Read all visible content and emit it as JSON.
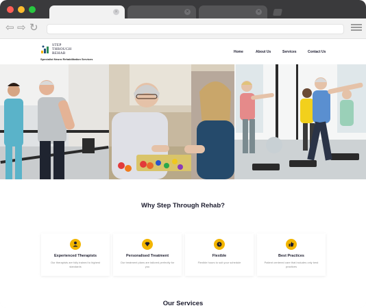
{
  "browser": {
    "tabs": [
      {
        "label": "",
        "close": "×"
      },
      {
        "label": "",
        "close": "×"
      },
      {
        "label": "",
        "close": "×"
      }
    ],
    "nav": {
      "back": "⇦",
      "forward": "⇨",
      "reload": "↻"
    },
    "url": ""
  },
  "site": {
    "logo_line1": "STEP",
    "logo_line2": "THROUGH",
    "logo_line3": "REHAB",
    "tagline": "Specialist Neuro Rehabilitation Services",
    "nav": [
      "Home",
      "About Us",
      "Services",
      "Contact Us"
    ]
  },
  "hero": {
    "panels": [
      "therapist-helping-patient-photo",
      "senior-woman-playing-board-game-photo",
      "seniors-exercise-class-photo"
    ]
  },
  "why": {
    "heading": "Why Step Through Rehab?",
    "cards": [
      {
        "icon": "person-icon",
        "title": "Experienced Therapists",
        "desc": "Our therapists are fully trained to highest standards"
      },
      {
        "icon": "gem-icon",
        "title": "Personalised Treatment",
        "desc": "Our treatment plans are tailored perfectly for you"
      },
      {
        "icon": "clock-icon",
        "title": "Flexible",
        "desc": "Flexible hours to suit your schedule"
      },
      {
        "icon": "thumbs-up-icon",
        "title": "Best Practices",
        "desc": "Patient centered care that includes only best practices"
      }
    ]
  },
  "services": {
    "heading": "Our Services"
  },
  "colors": {
    "accent": "#f2b500",
    "heading": "#1c1c2e",
    "chrome": "#3a3a3c"
  }
}
